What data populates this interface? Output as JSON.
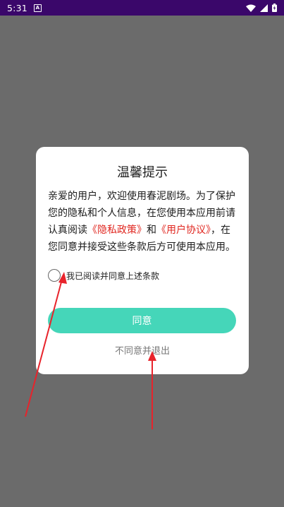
{
  "status_bar": {
    "time": "5:31",
    "notification_letter": "A"
  },
  "dialog": {
    "title": "温馨提示",
    "body_part1": "亲爱的用户，欢迎使用春泥剧场。为了保护您的隐私和个人信息，在您使用本应用前请认真阅读",
    "privacy_link": "《隐私政策》",
    "conjunction": "和",
    "agreement_link": "《用户协议》",
    "body_part2": "，在您同意并接受这些条款后方可使用本应用。",
    "checkbox_label": "我已阅读并同意上述条款",
    "agree_button": "同意",
    "disagree_link": "不同意并退出"
  },
  "colors": {
    "status_bar": "#3a076a",
    "overlay": "#6b6b6b",
    "accent_button": "#45d6b9",
    "link": "#e0261f",
    "arrow": "#e8232b"
  }
}
